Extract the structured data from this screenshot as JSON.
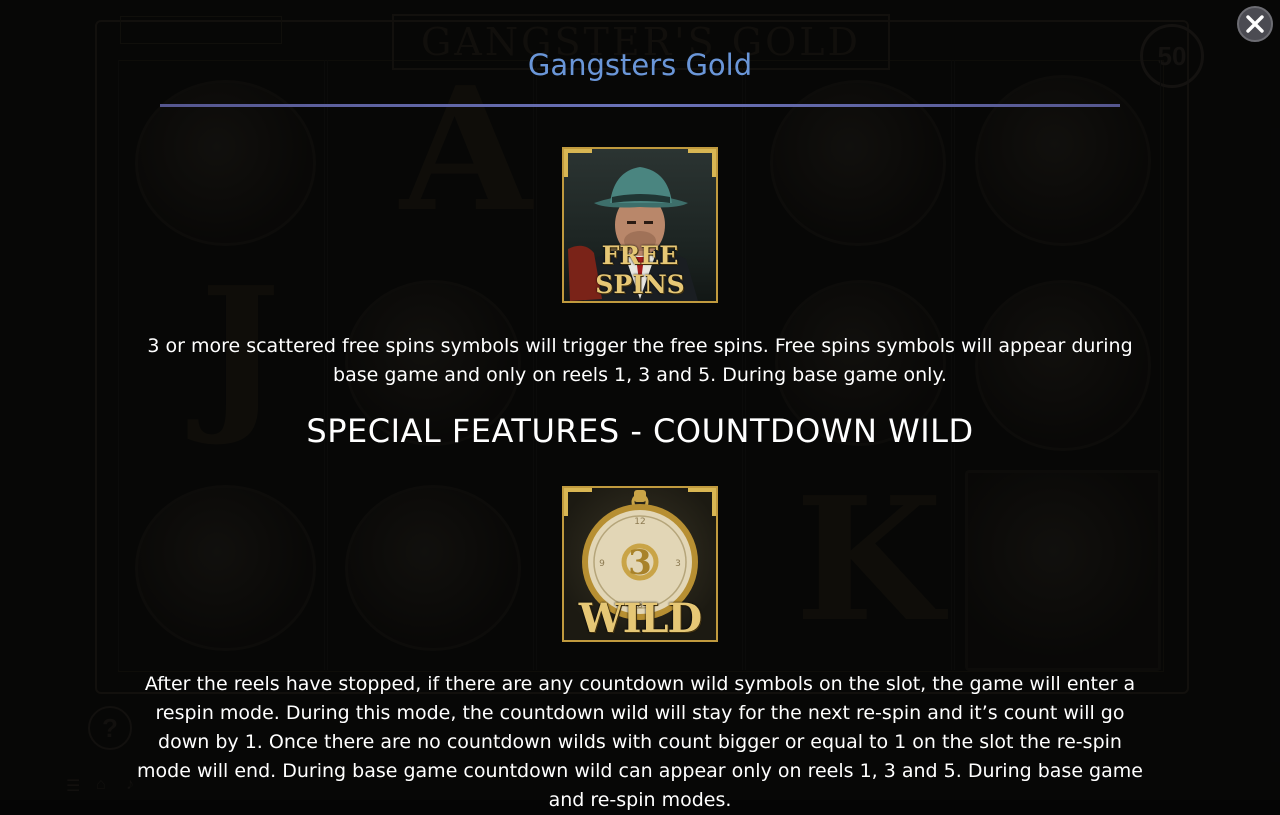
{
  "overlay": {
    "title": "Gangsters Gold",
    "free_spins_symbol": {
      "label": "FREE SPINS",
      "icon": "gangster-free-spins-icon"
    },
    "free_spins_text": "3 or more scattered free spins symbols will trigger the free spins. Free spins symbols will appear during base game and only on reels 1, 3 and 5. During base game only.",
    "section_heading": "SPECIAL FEATURES - COUNTDOWN WILD",
    "wild_symbol": {
      "label": "WILD",
      "count": "3",
      "icon": "pocket-watch-wild-icon"
    },
    "countdown_text": "After the reels have stopped, if there are any countdown wild symbols on the slot, the game will enter a respin mode. During this mode, the countdown wild will stay for the next re-spin and it’s count will go down by 1. Once there are no countdown wilds with count bigger or equal to 1 on the slot the re-spin mode will end. During base game countdown wild can appear only on reels 1, 3 and 5. During base game and re-spin modes."
  },
  "backdrop": {
    "logo_text": "GANGSTER'S GOLD",
    "badge_value": "50",
    "help_label": "?"
  },
  "colors": {
    "title": "#6a96d8",
    "rule": "#6a72b8",
    "symbol_frame": "#c09a3e",
    "text": "#ffffff"
  }
}
